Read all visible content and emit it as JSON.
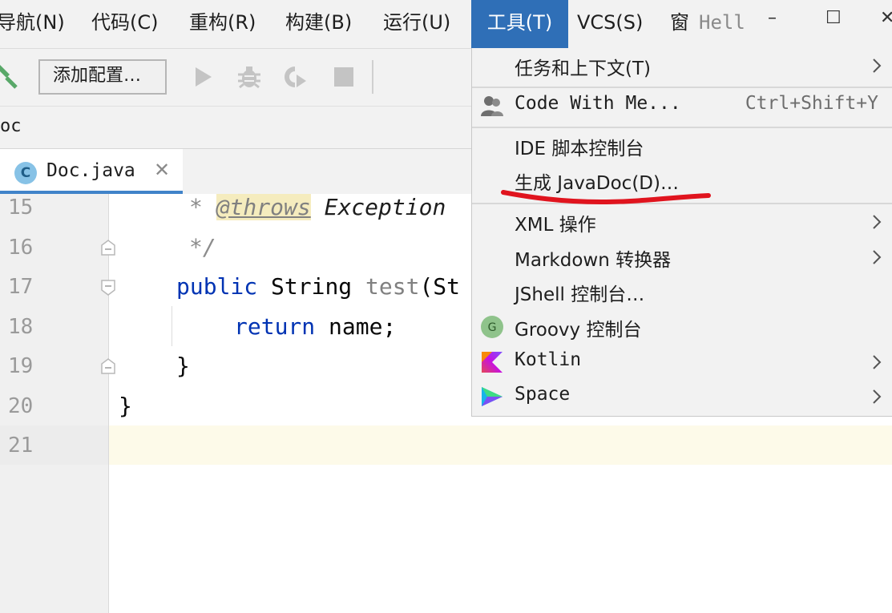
{
  "menubar": {
    "items": [
      {
        "label": "导航(N)",
        "mnemonic": "N"
      },
      {
        "label": "代码(C)",
        "mnemonic": "C"
      },
      {
        "label": "重构(R)",
        "mnemonic": "R"
      },
      {
        "label": "构建(B)",
        "mnemonic": "B"
      },
      {
        "label": "运行(U)",
        "mnemonic": "U"
      },
      {
        "label": "工具(T)",
        "mnemonic": "T",
        "active": true
      },
      {
        "label": "VCS(S)",
        "mnemonic": "S"
      },
      {
        "label": "窗",
        "mnemonic": ""
      }
    ],
    "project_title": "Hell",
    "minimize_glyph": "–",
    "maximize_glyph": "☐",
    "close_glyph": "✕"
  },
  "toolbar": {
    "config_label": "添加配置…",
    "icons": [
      "hammer-icon",
      "run-icon",
      "debug-icon",
      "coverage-icon",
      "stop-icon"
    ]
  },
  "breadcrumb": {
    "label": "oc"
  },
  "tab": {
    "icon_letter": "C",
    "label": "Doc.java",
    "close_glyph": "✕"
  },
  "editor": {
    "line_numbers": [
      "15",
      "16",
      "17",
      "18",
      "19",
      "20",
      "21"
    ],
    "lines": {
      "l15_star": "* ",
      "l15_tag": "@throws",
      "l15_text": " Exception",
      "l16": "*/",
      "l17_kw": "public",
      "l17_type": " String ",
      "l17_method": "test",
      "l17_rest": "(St",
      "l18_kw": "return",
      "l18_rest": " name;",
      "l19": "}",
      "l20": "}"
    }
  },
  "tools_menu": {
    "items": [
      {
        "label": "任务和上下文(T)",
        "shortcut": "",
        "submenu": true,
        "icon": ""
      },
      {
        "label": "Code With Me...",
        "shortcut": "Ctrl+Shift+Y",
        "submenu": false,
        "icon": "code-with-me-icon"
      },
      {
        "label": "IDE 脚本控制台",
        "shortcut": "",
        "submenu": false,
        "icon": ""
      },
      {
        "label": "生成 JavaDoc(D)…",
        "shortcut": "",
        "submenu": false,
        "icon": ""
      },
      {
        "label": "XML 操作",
        "shortcut": "",
        "submenu": true,
        "icon": ""
      },
      {
        "label": "Markdown 转换器",
        "shortcut": "",
        "submenu": true,
        "icon": ""
      },
      {
        "label": "JShell 控制台…",
        "shortcut": "",
        "submenu": false,
        "icon": ""
      },
      {
        "label": "Groovy 控制台",
        "shortcut": "",
        "submenu": false,
        "icon": "groovy-icon"
      },
      {
        "label": "Kotlin",
        "shortcut": "",
        "submenu": true,
        "icon": "kotlin-icon"
      },
      {
        "label": "Space",
        "shortcut": "",
        "submenu": true,
        "icon": "space-icon"
      }
    ],
    "groovy_icon_letter": "G"
  },
  "colors": {
    "menu_active": "#2f6fb7",
    "annotation_stroke": "#e0141e",
    "keyword": "#0033b3",
    "tab_underline": "#4083c9"
  }
}
